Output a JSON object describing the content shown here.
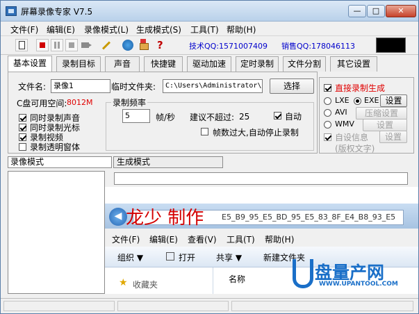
{
  "window": {
    "title": "屏幕录像专家 V7.5"
  },
  "menu": [
    "文件(F)",
    "编辑(E)",
    "录像模式(L)",
    "生成模式(S)",
    "工具(T)",
    "帮助(H)"
  ],
  "toolbar": {
    "support_text": "技术QQ:1571007409",
    "sales_text": "销售QQ:178046113"
  },
  "tabs": [
    "基本设置",
    "录制目标",
    "声音",
    "快捷键",
    "驱动加速",
    "定时录制",
    "文件分割",
    "其它设置"
  ],
  "settings": {
    "filename_label": "文件名:",
    "filename_value": "录像1",
    "tempdir_label": "临时文件夹:",
    "tempdir_value": "C:\\Users\\Administrator\\",
    "choose_button": "选择",
    "disk_label": "C盘可用空间:",
    "disk_value": "8012M",
    "checkboxes": [
      "同时录制声音",
      "同时录制光标",
      "录制视频",
      "录制透明窗体"
    ],
    "framerate": {
      "group_label": "录制频率",
      "value": "5",
      "unit": "帧/秒",
      "suggest": "建议不超过:",
      "suggest_value": "25",
      "auto": "自动",
      "auto_stop": "帧数过大,自动停止录制"
    }
  },
  "output": {
    "direct": "直接录制生成",
    "lxe": "LXE",
    "exe": "EXE",
    "avi": "AVI",
    "wmv": "WMV",
    "settings_button": "设置",
    "compress_button": "压缩设置",
    "custom_info": "自设信息",
    "copyright_text": "(版权文字)"
  },
  "modes": {
    "record": "录像模式",
    "generate": "生成模式"
  },
  "preview": {
    "watermark": "龙少 制作",
    "address": "E5_B9_95_E5_BD_95_E5_83_8F_E4_B8_93_E5",
    "menu": [
      "文件(F)",
      "编辑(E)",
      "查看(V)",
      "工具(T)",
      "帮助(H)"
    ],
    "toolbar": [
      "组织 ▼",
      "打开",
      "共享 ▼",
      "新建文件夹"
    ],
    "col_name": "名称",
    "fav": "收藏夹"
  },
  "logo": {
    "brand": "盘量产网",
    "url": "WWW.UPANTOOL.COM"
  }
}
